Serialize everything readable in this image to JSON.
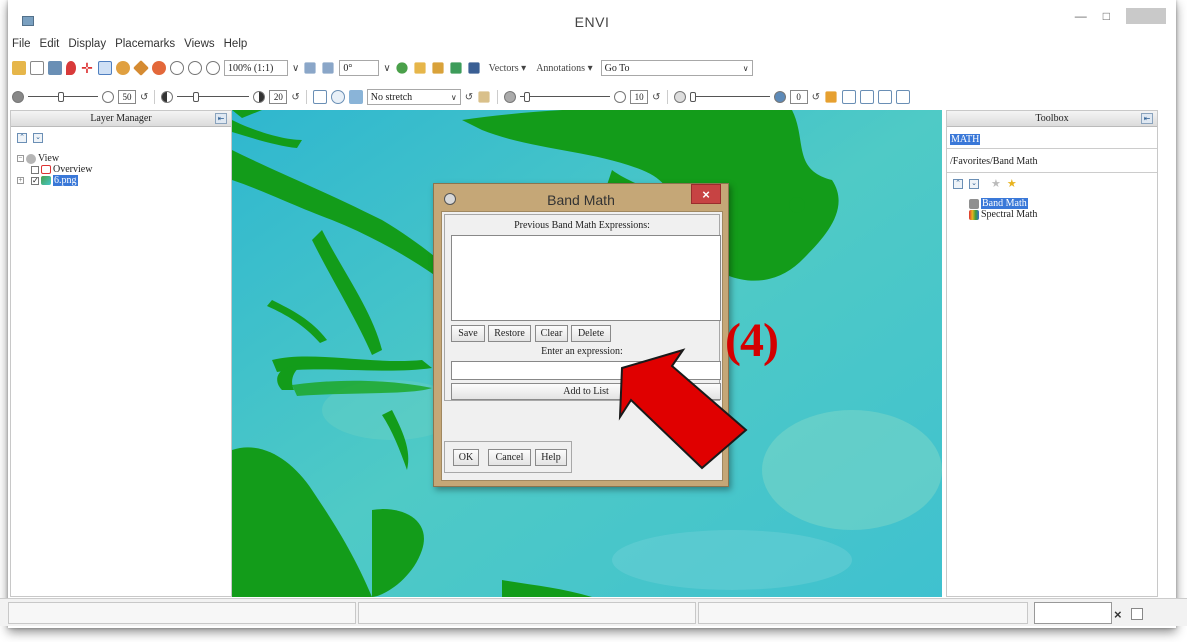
{
  "app": {
    "title": "ENVI"
  },
  "menu": [
    "File",
    "Edit",
    "Display",
    "Placemarks",
    "Views",
    "Help"
  ],
  "toolbar1": {
    "zoom_value": "100% (1:1)",
    "rotation_value": "0°",
    "vectors_label": "Vectors",
    "annotations_label": "Annotations",
    "goto_value": "Go To"
  },
  "toolbar2": {
    "brightness_value": "50",
    "contrast_value": "20",
    "stretch_value": "No stretch",
    "sharpen_value": "10",
    "transparency_value": "0"
  },
  "layer_manager": {
    "title": "Layer Manager",
    "items": [
      {
        "label": "View"
      },
      {
        "label": "Overview"
      },
      {
        "label": "6.png"
      }
    ]
  },
  "toolbox": {
    "title": "Toolbox",
    "search_value": "MATH",
    "path": "/Favorites/Band Math",
    "items": [
      {
        "label": "Band Math"
      },
      {
        "label": "Spectral Math"
      }
    ]
  },
  "dialog": {
    "title": "Band Math",
    "previous_label": "Previous Band Math Expressions:",
    "save_label": "Save",
    "restore_label": "Restore",
    "clear_label": "Clear",
    "delete_label": "Delete",
    "enter_label": "Enter an expression:",
    "add_label": "Add to List",
    "ok_label": "OK",
    "cancel_label": "Cancel",
    "help_label": "Help",
    "close_glyph": "×"
  },
  "annotation": {
    "step_label": "(4)",
    "arrow_color": "#e00000"
  },
  "colors": {
    "image_teal": "#45c7c9",
    "image_green": "#139c1a",
    "dialog_frame": "#c5a777"
  },
  "status": {
    "close_glyph": "×"
  }
}
